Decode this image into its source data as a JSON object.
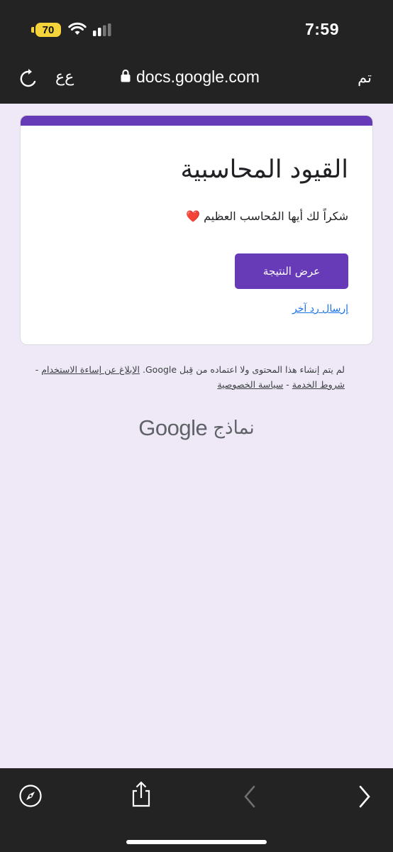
{
  "status_bar": {
    "battery": "70",
    "time": "7:59"
  },
  "browser": {
    "text_size": "ﻉﻉ",
    "url": "docs.google.com",
    "done": "تم"
  },
  "form": {
    "title": "القيود المحاسبية",
    "message": "شكراً لك أيها المُحاسب العظيم ❤️",
    "view_score_label": "عرض النتيجة",
    "another_response_label": "إرسال رد آخر"
  },
  "footer": {
    "disclaimer_text": "لم يتم إنشاء هذا المحتوى ولا اعتماده من قِبل Google.",
    "report_abuse": "الإبلاغ عن إساءة الاستخدام",
    "separator": " - ",
    "terms": "شروط الخدمة",
    "privacy": "سياسة الخصوصية",
    "brand_google": "Google",
    "brand_forms": "نماذج"
  },
  "colors": {
    "accent": "#673ab7",
    "page_bg": "#efe9f7",
    "chrome_bg": "#232323",
    "battery": "#f5d33b",
    "link": "#1a73e8"
  },
  "icons": {
    "wifi": "wifi-icon",
    "signal": "cellular-signal-icon",
    "reload": "reload-icon",
    "lock": "lock-icon",
    "compass": "compass-icon",
    "share": "share-icon",
    "back": "chevron-left-icon",
    "forward": "chevron-right-icon"
  }
}
